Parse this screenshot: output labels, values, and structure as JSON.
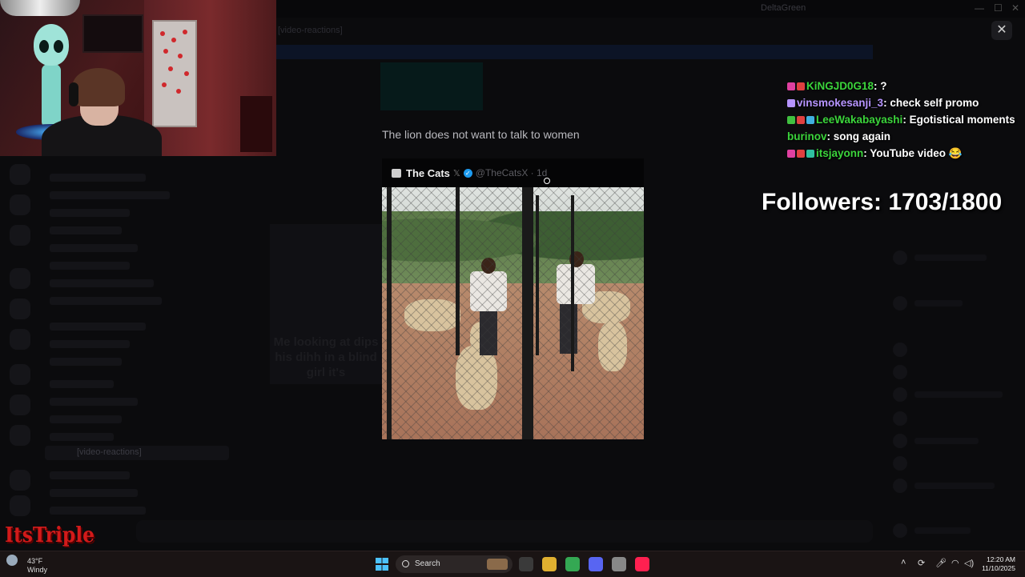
{
  "window": {
    "title": "DeltaGreen"
  },
  "channel": {
    "name": "[video-reactions]"
  },
  "meme": {
    "caption": "The lion does not want to talk to women",
    "tweet": {
      "name": "The Cats",
      "x_mark": "𝕏",
      "handle": "@TheCatsX · 1d"
    }
  },
  "background_meme_text": "Me looking at dips his dihh in a blind girl it's",
  "chat": [
    {
      "user": "KiNGJD0G18",
      "color": "#3bd43b",
      "message": "?",
      "badges": [
        "#e040a0",
        "#e04040"
      ]
    },
    {
      "user": "vinsmokesanji_3",
      "color": "#b694ff",
      "message": "check self promo",
      "badges": [
        "#b694ff"
      ]
    },
    {
      "user": "LeeWakabayashi",
      "color": "#3bd43b",
      "message": "Egotistical moments",
      "badges": [
        "#40c040",
        "#e04040",
        "#40b0e0"
      ]
    },
    {
      "user": "burinov",
      "color": "#3bd43b",
      "message": "song again",
      "badges": []
    },
    {
      "user": "itsjayonn",
      "color": "#3bd43b",
      "message": "YouTube video 😂",
      "badges": [
        "#e040a0",
        "#e04040",
        "#30c0a0"
      ]
    }
  ],
  "followers": {
    "text": "Followers: 1703/1800",
    "current": 1703,
    "goal": 1800
  },
  "logo_text": "ItsTriple",
  "taskbar": {
    "weather_temp": "43°F",
    "weather_desc": "Windy",
    "search_label": "Search",
    "time": "12:20 AM",
    "date": "11/10/2025",
    "app_colors": [
      "#3a3a3a",
      "#e0b030",
      "#34a853",
      "#5865f2",
      "#888888",
      "#ff2050"
    ]
  }
}
